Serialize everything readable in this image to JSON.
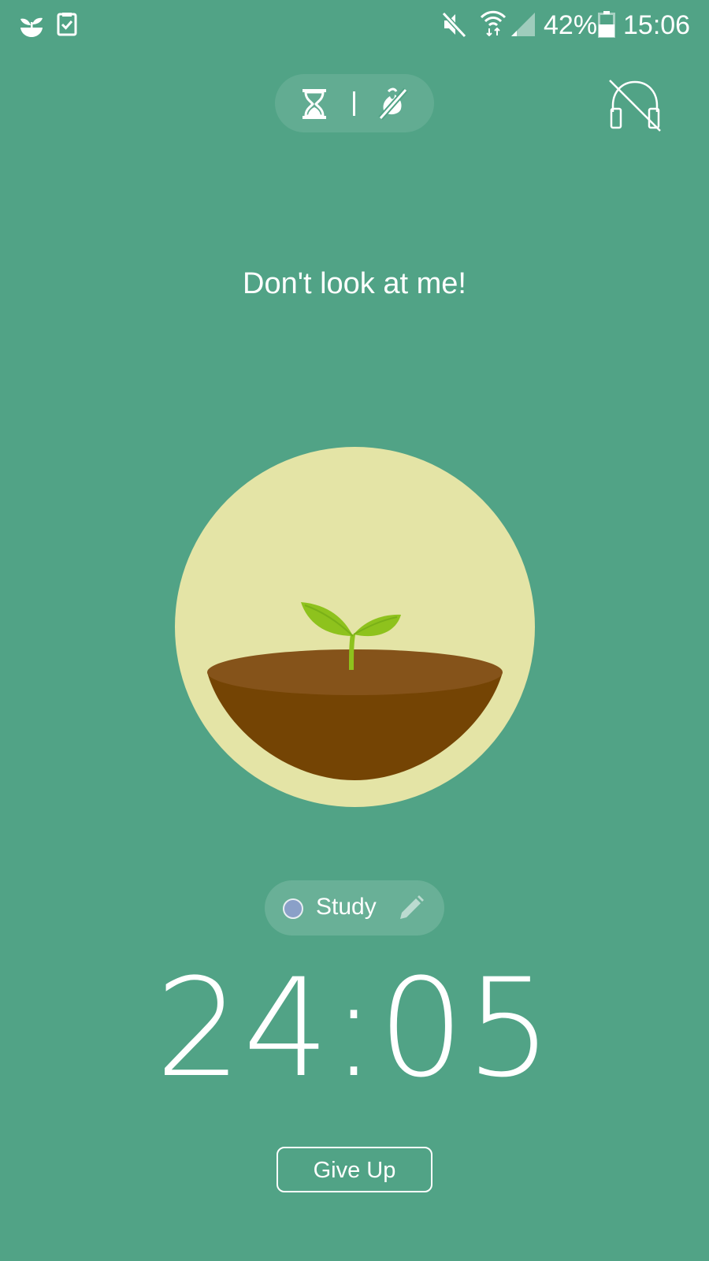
{
  "status_bar": {
    "battery_percent": "42%",
    "time": "15:06",
    "icons": [
      "forest-app-icon",
      "task-check-icon",
      "mute-icon",
      "wifi-icon",
      "signal-icon",
      "battery-icon"
    ]
  },
  "mode_toggle": {
    "icons": [
      "hourglass-icon",
      "no-phone-icon"
    ]
  },
  "prompt": "Don't look at me!",
  "tag": {
    "label": "Study",
    "color": "#8aa0c8"
  },
  "timer": "24:05",
  "give_up_label": "Give Up",
  "colors": {
    "background": "#51a386",
    "circle": "#e4e4a6",
    "soil_top": "#85531a",
    "soil": "#744404",
    "sprout": "#8ec21d"
  }
}
